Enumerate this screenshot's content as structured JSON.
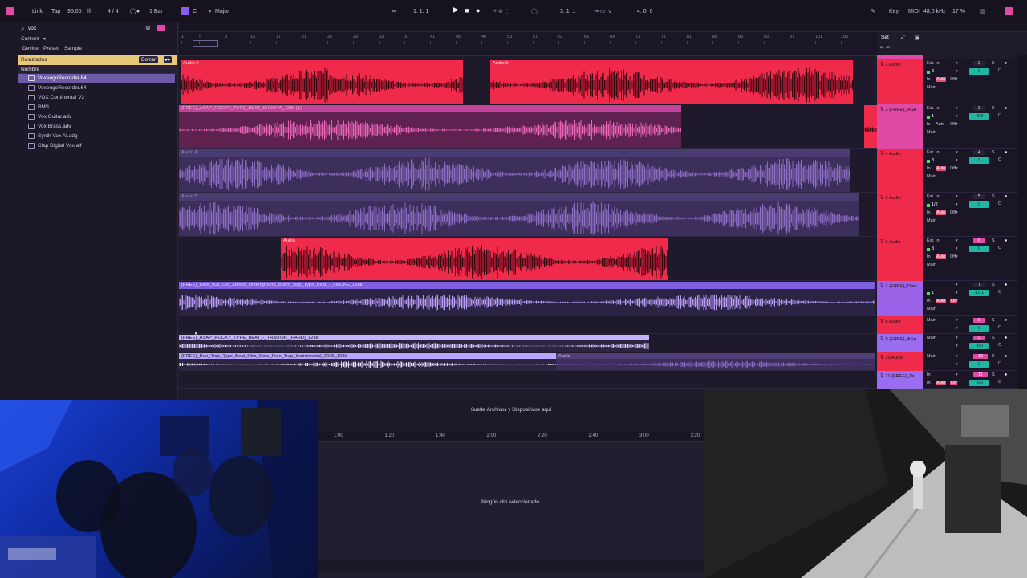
{
  "transport": {
    "link": "Link",
    "tap": "Tap",
    "bpm": "95.00",
    "time_sig": "4 / 4",
    "quantize": "1 Bar",
    "key_root": "C",
    "scale": "Major",
    "position": "1.   1.   1",
    "loop_start": "3.   1.   1",
    "loop_length": "4.   0.   0",
    "key_label": "Key",
    "midi_label": "MIDI",
    "sample_rate": "48.0 kHz",
    "cpu": "17 %"
  },
  "browser": {
    "search_value": "vox",
    "category": "Content",
    "filters": [
      "Device",
      "Preset",
      "Sample"
    ],
    "results_label": "Resultados",
    "clear_label": "Borrar",
    "column_header": "Nombre",
    "files": [
      "VoxengoRecorder.64",
      "VoxengoRecorder.64",
      "VOX Continental V2",
      "BMS",
      "Vox Guitar.adv",
      "Vox Brass.adv",
      "Synth Vox AI.adg",
      "Clap Digital Vox.aif"
    ]
  },
  "ruler": {
    "set_label": "Set",
    "bars": [
      "1",
      "5",
      "9",
      "13",
      "17",
      "21",
      "25",
      "29",
      "33",
      "37",
      "41",
      "45",
      "49",
      "53",
      "57",
      "61",
      "65",
      "69",
      "73",
      "77",
      "81",
      "85",
      "89",
      "93",
      "97",
      "101",
      "105"
    ]
  },
  "tracks": [
    {
      "name": "2 Audio",
      "color": "#ef2a4a",
      "input": "Ext. In",
      "channel": "3",
      "monitor": "Auto",
      "route": "Main",
      "number": "2",
      "volume": "0"
    },
    {
      "name": "3 (FREE)_ASA",
      "color": "#e04aa6",
      "input": "Ext. In",
      "channel": "1",
      "monitor": "Auto",
      "route": "Main",
      "number": "3",
      "volume": "-3.0"
    },
    {
      "name": "4 Audio",
      "color": "#ef2a4a",
      "input": "Ext. In",
      "channel": "3",
      "monitor": "Auto",
      "route": "Main",
      "number": "4",
      "volume": "0"
    },
    {
      "name": "5 Audio",
      "color": "#ef2a4a",
      "input": "Ext. In",
      "channel": "1/2",
      "monitor": "Auto",
      "route": "Main",
      "number": "5",
      "volume": "0"
    },
    {
      "name": "6 Audio",
      "color": "#ef2a4a",
      "input": "Ext. In",
      "channel": "3",
      "monitor": "Auto",
      "route": "Main",
      "number": "6",
      "volume": "0"
    },
    {
      "name": "7 (FREE)_Dark",
      "color": "#9a63e8",
      "input": "",
      "channel": "1",
      "monitor": "Auto",
      "route": "Main",
      "number": "7",
      "volume": "-10.0"
    },
    {
      "name": "8 Audio",
      "color": "#ef2a4a",
      "input": "Main",
      "channel": "",
      "monitor": "",
      "route": "",
      "number": "8",
      "volume": "0"
    },
    {
      "name": "9 (FREE)_ASA",
      "color": "#9a6cf0",
      "input": "Main",
      "channel": "",
      "monitor": "",
      "route": "",
      "number": "9",
      "volume": "-5.0"
    },
    {
      "name": "10 Audio",
      "color": "#ef2a4a",
      "input": "Main",
      "channel": "",
      "monitor": "",
      "route": "",
      "number": "10",
      "volume": "0"
    },
    {
      "name": "11 (FREE)_Du",
      "color": "#9a6cf0",
      "input": "In",
      "channel": "",
      "monitor": "Auto",
      "route": "Main",
      "number": "11",
      "volume": "-5.0"
    }
  ],
  "clips": {
    "c1a": "Audio 6",
    "c1b": "Audio 5",
    "c2": "(FREE)_ASAP_ROCKY_TYPE_BEAT_SHOOTA_128k (1)",
    "c3": "Audio 4",
    "c4": "Audio 5",
    "c5": "Audio",
    "c6": "(FREE)_Dark_90s_Old_School_Underground_Boom_Bap_Type_Beat_-_SMOKE_128k",
    "c7": "(FREE)_ASAP_ROCKY_TYPE_BEAT_-_TRAITOR_[HARD]_128k",
    "c8": "(FREE)_Duo_Trap_Type_Beat_Otro_Coro_Free_Trap_Instrumental_2025_128k",
    "c8b": "Audio"
  },
  "detail": {
    "drop_text": "Suelte Archivos y Dispositivos aquí",
    "empty_text": "Ningún clip seleccionado.",
    "times": [
      "1:00",
      "1:20",
      "1:40",
      "2:00",
      "2:20",
      "2:40",
      "3:00",
      "3:20"
    ]
  },
  "mixer_labels": {
    "in": "In",
    "auto": "Auto",
    "off": "Off",
    "s": "S",
    "c": "C"
  }
}
